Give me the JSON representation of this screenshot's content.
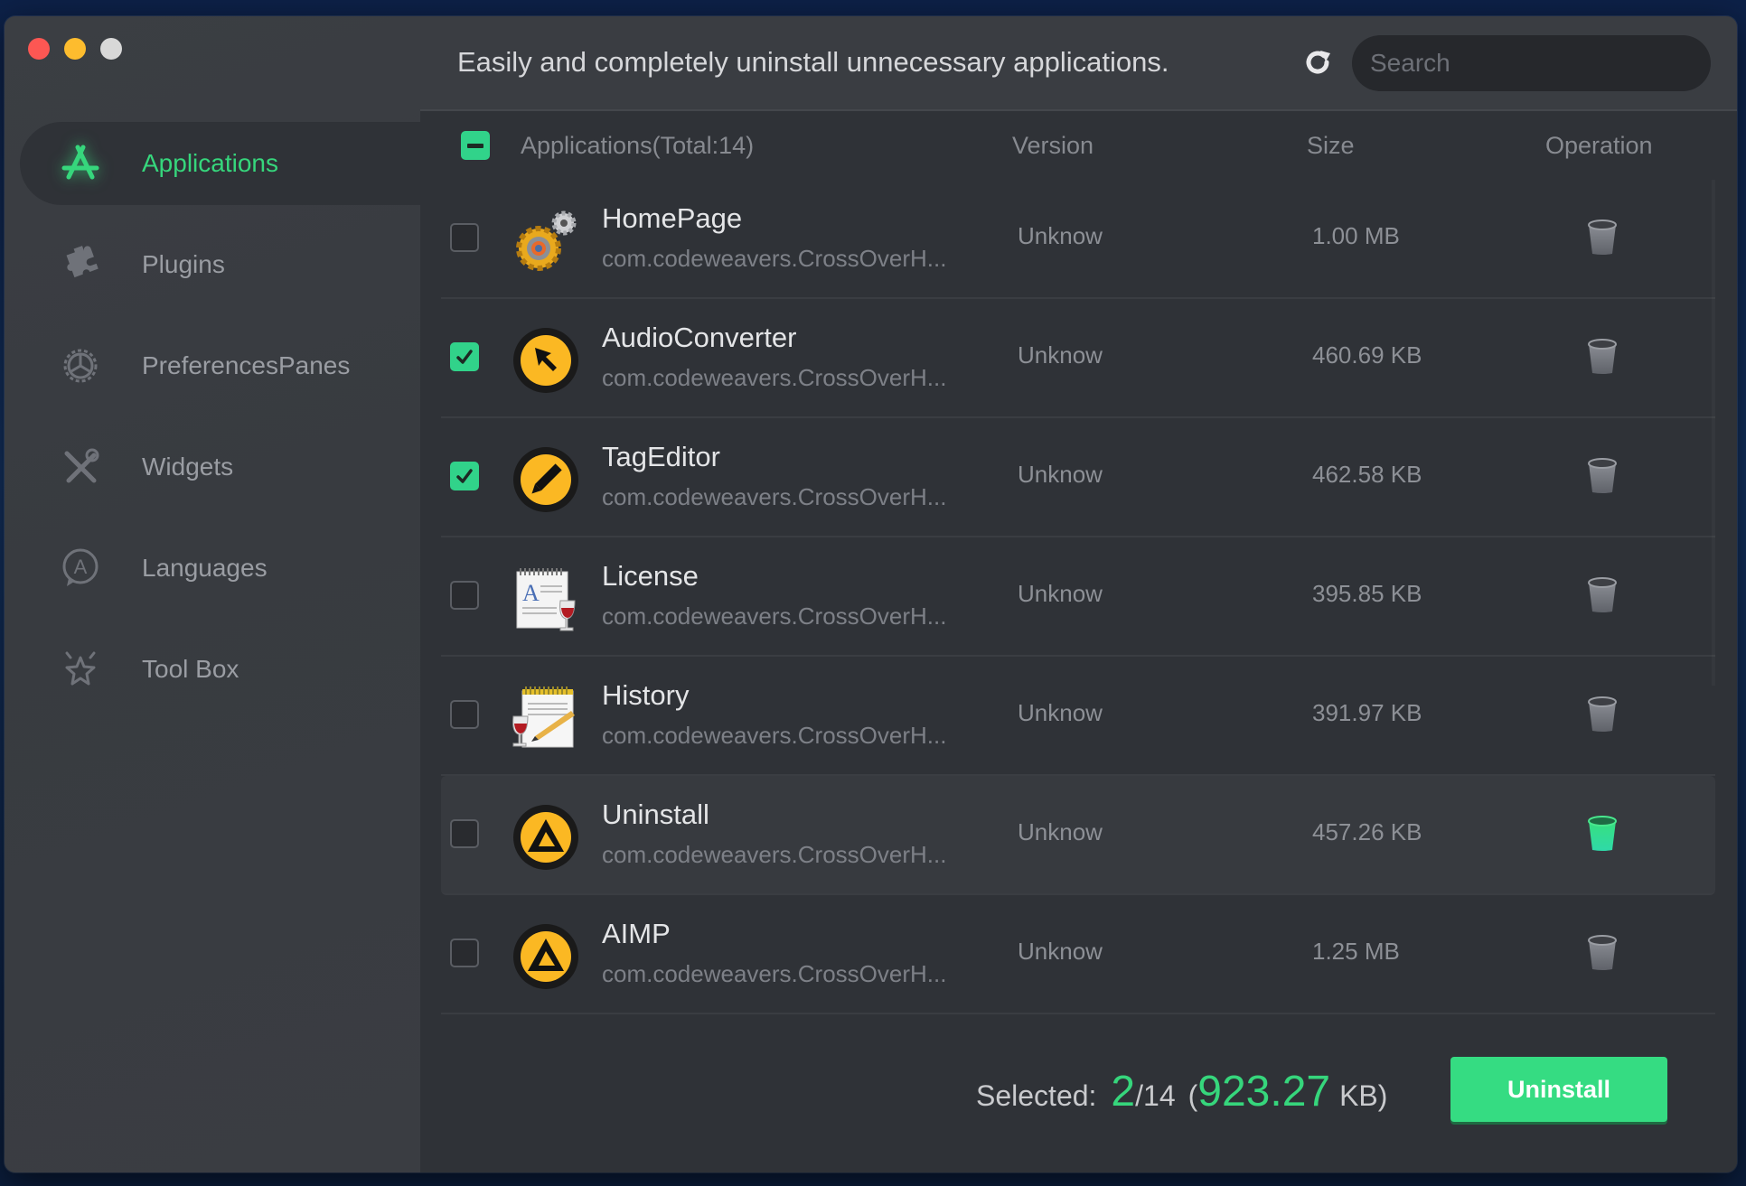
{
  "window": {
    "controls": [
      "close",
      "minimize",
      "zoom"
    ]
  },
  "sidebar": {
    "items": [
      {
        "label": "Applications",
        "icon": "app-store-icon",
        "active": true
      },
      {
        "label": "Plugins",
        "icon": "puzzle-icon",
        "active": false
      },
      {
        "label": "PreferencesPanes",
        "icon": "gear-icon",
        "active": false
      },
      {
        "label": "Widgets",
        "icon": "tools-icon",
        "active": false
      },
      {
        "label": "Languages",
        "icon": "language-bubble-icon",
        "active": false
      },
      {
        "label": "Tool Box",
        "icon": "star-icon",
        "active": false
      }
    ]
  },
  "header": {
    "tagline": "Easily and completely uninstall unnecessary applications.",
    "refresh_icon": "refresh-icon",
    "search": {
      "placeholder": "Search",
      "value": ""
    }
  },
  "table": {
    "select_all_state": "partial",
    "columns": {
      "name": "Applications(Total:14)",
      "version": "Version",
      "size": "Size",
      "operation": "Operation"
    },
    "rows": [
      {
        "name": "HomePage",
        "bundle": "com.codeweavers.CrossOverH...",
        "version": "Unknow",
        "size": "1.00 MB",
        "checked": false,
        "icon": "crossover-gear-icon",
        "hover": false
      },
      {
        "name": "AudioConverter",
        "bundle": "com.codeweavers.CrossOverH...",
        "version": "Unknow",
        "size": "460.69 KB",
        "checked": true,
        "icon": "cursor-arrow-icon",
        "hover": false
      },
      {
        "name": "TagEditor",
        "bundle": "com.codeweavers.CrossOverH...",
        "version": "Unknow",
        "size": "462.58 KB",
        "checked": true,
        "icon": "pencil-icon",
        "hover": false
      },
      {
        "name": "License",
        "bundle": "com.codeweavers.CrossOverH...",
        "version": "Unknow",
        "size": "395.85 KB",
        "checked": false,
        "icon": "text-document-wine-icon",
        "hover": false
      },
      {
        "name": "History",
        "bundle": "com.codeweavers.CrossOverH...",
        "version": "Unknow",
        "size": "391.97 KB",
        "checked": false,
        "icon": "notepad-wine-icon",
        "hover": false
      },
      {
        "name": "Uninstall",
        "bundle": "com.codeweavers.CrossOverH...",
        "version": "Unknow",
        "size": "457.26 KB",
        "checked": false,
        "icon": "aimp-logo-icon",
        "hover": true
      },
      {
        "name": "AIMP",
        "bundle": "com.codeweavers.CrossOverH...",
        "version": "Unknow",
        "size": "1.25 MB",
        "checked": false,
        "icon": "aimp-logo-icon",
        "hover": false
      }
    ]
  },
  "footer": {
    "selected_label": "Selected:",
    "selected_count": "2",
    "total_count": "/14",
    "open_paren": "(",
    "selected_size": "923.27",
    "size_unit": "KB)",
    "uninstall_label": "Uninstall"
  },
  "colors": {
    "accent": "#36d67c",
    "button": "#35dc82"
  }
}
